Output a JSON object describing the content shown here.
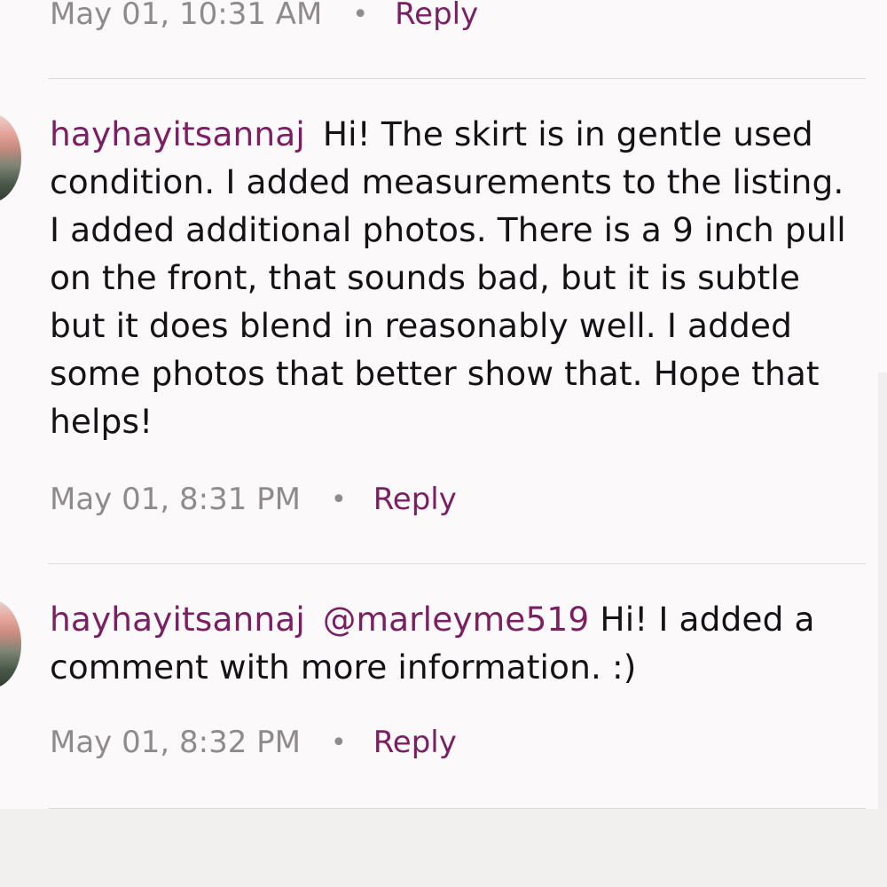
{
  "comments": [
    {
      "timestamp": "May 01, 10:31 AM",
      "separator": "•",
      "reply_label": "Reply"
    },
    {
      "username": "hayhayitsannaj",
      "text": "Hi! The skirt is in gentle used condition. I added measurements to the listing. I added additional photos. There is a 9 inch pull on the front, that sounds bad, but it is subtle but it does blend in reasonably well. I added some photos that better show that. Hope that helps!",
      "timestamp": "May 01, 8:31 PM",
      "separator": "•",
      "reply_label": "Reply"
    },
    {
      "username": "hayhayitsannaj",
      "mention": "@marleyme519",
      "text": "Hi! I added a comment with more information. :)",
      "timestamp": "May 01, 8:32 PM",
      "separator": "•",
      "reply_label": "Reply"
    }
  ],
  "colors": {
    "username": "#7a1f62",
    "reply": "#7a1f62",
    "timestamp": "#8f8a8c",
    "body_text": "#141214",
    "background": "#fbf9fa"
  }
}
